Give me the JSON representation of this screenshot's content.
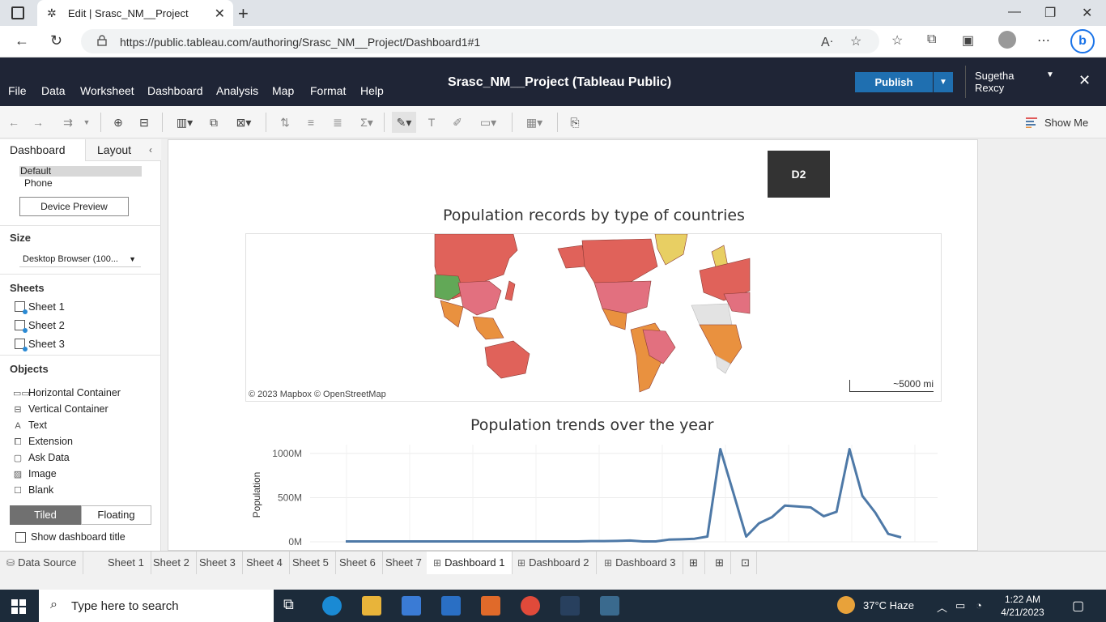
{
  "browser": {
    "tab_title": "Edit | Srasc_NM__Project",
    "url": "https://public.tableau.com/authoring/Srasc_NM__Project/Dashboard1#1"
  },
  "tableau": {
    "menu": [
      "File",
      "Data",
      "Worksheet",
      "Dashboard",
      "Analysis",
      "Map",
      "Format",
      "Help"
    ],
    "project_title": "Srasc_NM__Project (Tableau Public)",
    "publish_label": "Publish",
    "user_name": "Sugetha Rexcy",
    "show_me_label": "Show Me"
  },
  "left_panel": {
    "tabs": [
      "Dashboard",
      "Layout"
    ],
    "devices": [
      "Default",
      "Phone"
    ],
    "device_preview_label": "Device Preview",
    "size_heading": "Size",
    "size_value": "Desktop Browser (100...",
    "sheets_heading": "Sheets",
    "sheets": [
      "Sheet 1",
      "Sheet 2",
      "Sheet 3"
    ],
    "objects_heading": "Objects",
    "objects": [
      {
        "label": "Horizontal Container",
        "icon": "horizontal-container-icon"
      },
      {
        "label": "Vertical Container",
        "icon": "vertical-container-icon"
      },
      {
        "label": "Text",
        "icon": "text-icon"
      },
      {
        "label": "Extension",
        "icon": "extension-icon"
      },
      {
        "label": "Ask Data",
        "icon": "ask-data-icon"
      },
      {
        "label": "Image",
        "icon": "image-icon"
      },
      {
        "label": "Blank",
        "icon": "blank-icon"
      }
    ],
    "tiled_label": "Tiled",
    "floating_label": "Floating",
    "show_title_label": "Show dashboard title"
  },
  "dashboard": {
    "d2_label": "D2",
    "map_title": "Population records by type of countries",
    "map_attribution": "© 2023 Mapbox  © OpenStreetMap",
    "map_scale": "~5000 mi",
    "line_title": "Population trends over the year",
    "colors": {
      "map_red": "#e0625a",
      "map_pink": "#e2707f",
      "map_orange": "#e9913f",
      "map_green": "#62a857",
      "map_yellow": "#e8cf63",
      "map_gray": "#e3e3e3",
      "line": "#4e79a7"
    }
  },
  "chart_data": {
    "type": "line",
    "title": "Population trends over the year",
    "xlabel": "",
    "ylabel": "Population",
    "ylim": [
      0,
      1100
    ],
    "y_ticks": [
      "1000M",
      "500M",
      "0M"
    ],
    "y_tick_values": [
      1000,
      500,
      0
    ],
    "series": [
      {
        "values": [
          5,
          5,
          5,
          5,
          5,
          5,
          5,
          5,
          5,
          5,
          5,
          5,
          5,
          5,
          5,
          5,
          5,
          5,
          5,
          8,
          8,
          10,
          15,
          5,
          5,
          25,
          28,
          35,
          60,
          1050,
          560,
          60,
          210,
          280,
          410,
          400,
          390,
          290,
          340,
          1050,
          520,
          330,
          90,
          50
        ]
      }
    ],
    "grid": true
  },
  "sheet_tabs": {
    "data_source": "Data Source",
    "tabs": [
      "Sheet 1",
      "Sheet 2",
      "Sheet 3",
      "Sheet 4",
      "Sheet 5",
      "Sheet 6",
      "Sheet 7",
      "Dashboard 1",
      "Dashboard 2",
      "Dashboard 3"
    ],
    "active": "Dashboard 1"
  },
  "taskbar": {
    "search_placeholder": "Type here to search",
    "weather": "37°C  Haze",
    "time": "1:22 AM",
    "date": "4/21/2023"
  }
}
